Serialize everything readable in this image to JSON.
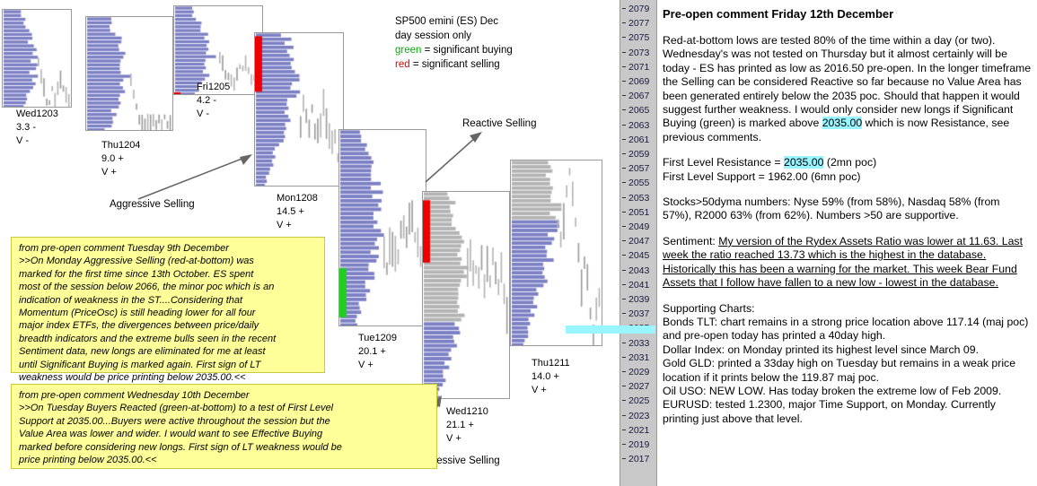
{
  "chart": {
    "legend": {
      "line1": "SP500 emini  (ES)  Dec",
      "line2": "day session only",
      "green_word": "green",
      "green_rest": " = significant buying",
      "red_word": "red",
      "red_rest": " = significant selling",
      "green_color": "#00b200",
      "red_color": "#e00000"
    },
    "annotations": [
      {
        "name": "aggressive-selling-1",
        "label": "Aggressive Selling"
      },
      {
        "name": "reactive-selling",
        "label": "Reactive Selling"
      },
      {
        "name": "aggressive-selling-2",
        "label": "Aggressive Selling"
      }
    ],
    "sessions": [
      {
        "name": "Wed1203",
        "value": "3.3 -",
        "v": "V -"
      },
      {
        "name": "Thu1204",
        "value": "9.0 +",
        "v": "V +"
      },
      {
        "name": "Fri1205",
        "value": "4.2 -",
        "v": "V -"
      },
      {
        "name": "Mon1208",
        "value": "14.5 +",
        "v": "V +"
      },
      {
        "name": "Tue1209",
        "value": "20.1 +",
        "v": "V +"
      },
      {
        "name": "Wed1210",
        "value": "21.1 +",
        "v": "V +"
      },
      {
        "name": "Thu1211",
        "value": "14.0 +",
        "v": "V +"
      }
    ],
    "yellow_notes": [
      {
        "name": "note-tuesday-9th",
        "text": "from pre-open comment Tuesday 9th December\n>>On Monday Aggressive Selling (red-at-bottom) was\nmarked for the first time since 13th October.  ES spent\nmost of the session below 2066, the minor poc which is an\nindication of weakness in the ST....Considering that\nMomentum (PriceOsc) is still heading lower for all four\nmajor index ETFs, the divergences between price/daily\nbreadth indicators and the extreme bulls seen in the recent\nSentiment data, new longs are eliminated for me at least\nuntil Significant Buying is marked again.   First sign of LT\nweakness would be price printing below 2035.00.<<"
      },
      {
        "name": "note-wednesday-10th",
        "text": "from pre-open comment Wednesday 10th December\n>>On Tuesday Buyers Reacted (green-at-bottom) to a test of First Level\nSupport at 2035.00...Buyers were active throughout the session but the\nValue Area was lower and wider.  I would want to see Effective Buying\nmarked before considering new longs.  First sign of LT weakness would be\nprice printing below 2035.00.<<"
      }
    ]
  },
  "price_axis": {
    "ticks": [
      2079,
      2077,
      2075,
      2073,
      2071,
      2069,
      2067,
      2065,
      2063,
      2061,
      2059,
      2057,
      2055,
      2053,
      2051,
      2049,
      2047,
      2045,
      2043,
      2041,
      2039,
      2037,
      2035,
      2033,
      2031,
      2029,
      2027,
      2025,
      2023,
      2021,
      2019,
      2017
    ],
    "marker_level": 2035,
    "marker_color": "#99f5ff"
  },
  "commentary": {
    "title": "Pre-open comment Friday 12th December",
    "para1_a": "Red-at-bottom lows are tested 80% of the time within a day (or two).  Wednesday's was not tested on Thursday but it almost certainly will be today - ES has printed as low as 2016.50 pre-open.   In the longer timeframe the Selling can be considered Reactive so far because no Value Area has been generated entirely below the 2035 poc.  Should that happen it would suggest further weakness.  I would only consider new longs if Significant Buying (green) is marked above ",
    "para1_hl": "2035.00",
    "para1_b": " which is now Resistance, see previous comments.",
    "resistance_label": "First Level Resistance  = ",
    "resistance_value": "2035.00",
    "resistance_suffix": " (2mn poc)",
    "support_line": "First Level Support = 1962.00  (6mn poc)",
    "stocks_para": "Stocks>50dyma numbers: Nyse 59% (from 58%), Nasdaq 58% (from 57%), R2000 63% (from 62%).  Numbers >50 are supportive.",
    "sentiment_label": "Sentiment: ",
    "sentiment_underlined": "My version of the Rydex Assets Ratio was lower at 11.63.  Last week the ratio reached 13.73 which is the highest in the database. Historically this has been a warning for the market.  This week Bear Fund Assets that I follow have fallen to a new low - lowest in the database.",
    "supporting_title": "Supporting Charts:",
    "supporting_lines": "Bonds TLT: chart remains in a strong price location above 117.14 (maj poc) and pre-open today has printed a 40day high.\nDollar Index: on Monday printed its highest level since March 09.\nGold GLD: printed a 33day high on Tuesday but remains in a weak price location if it prints below the 119.87 maj poc.\nOil USO: NEW LOW.  Has today broken the extreme low of Feb 2009.\nEURUSD: tested 1.2300, major Time Support, on Monday. Currently printing just above that level."
  }
}
